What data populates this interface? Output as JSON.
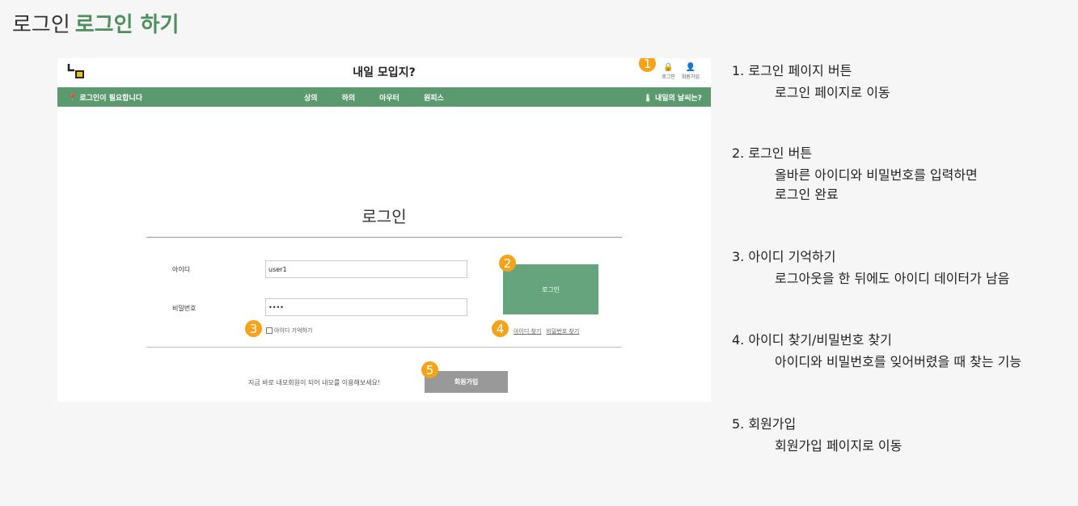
{
  "header": {
    "title_prefix": "로그인",
    "title_accent": "로그인 하기"
  },
  "site": {
    "title": "내일 모입지?",
    "top_actions": [
      {
        "icon": "lock-icon",
        "glyph": "🔒",
        "label": "로그인"
      },
      {
        "icon": "user-plus-icon",
        "glyph": "👤",
        "label": "회원가입"
      }
    ],
    "nav_left": "로그인이 필요합니다",
    "nav_left_icon": "📍",
    "nav_items": [
      "상의",
      "하의",
      "아우터",
      "원피스"
    ],
    "nav_right": "내일의 날씨는?",
    "nav_right_icon": "🌡"
  },
  "login": {
    "heading": "로그인",
    "id_label": "아이디",
    "id_value": "user1",
    "pw_label": "비밀번호",
    "pw_value": "••••",
    "login_button": "로그인",
    "remember_label": "아이디 기억하기",
    "find_id": "아이디 찾기",
    "find_pw": "비밀번호 찾기",
    "signup_prompt": "지금 바로 내모회원이 되어 내모를 이용해보세요!",
    "signup_button": "회원가입"
  },
  "badges": [
    "1",
    "2",
    "3",
    "4",
    "5"
  ],
  "notes": [
    {
      "title": "1.  로그인 페이지 버튼",
      "desc": "로그인 페이지로 이동"
    },
    {
      "title": "2.  로그인 버튼",
      "desc": "올바른 아이디와 비밀번호를 입력하면",
      "desc2": "로그인 완료"
    },
    {
      "title": "3. 아이디 기억하기",
      "desc": "로그아웃을 한 뒤에도 아이디 데이터가 남음"
    },
    {
      "title": "4. 아이디 찾기/비밀번호 찾기",
      "desc": "아이디와 비밀번호를 잊어버렸을 때 찾는 기능"
    },
    {
      "title": "5. 회원가입",
      "desc": "회원가입 페이지로 이동"
    }
  ],
  "colors": {
    "accent_green": "#4f8f5f",
    "nav_green": "#5a9a6e",
    "button_green": "#66a47e",
    "badge_orange": "#f5a41a",
    "signup_gray": "#999999"
  }
}
